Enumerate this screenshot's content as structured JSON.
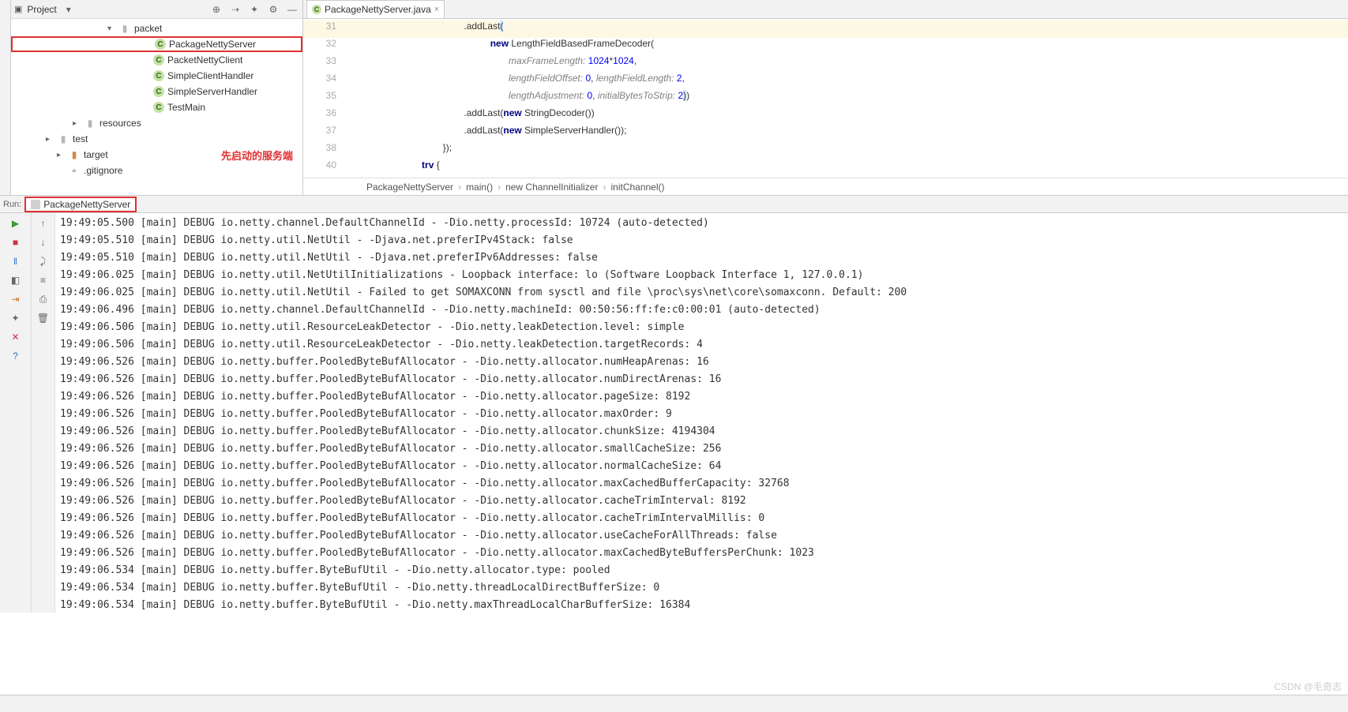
{
  "project_panel": {
    "title": "Project",
    "items": [
      {
        "type": "folder",
        "label": "packet",
        "indent": "indent1",
        "arrow": "▾"
      },
      {
        "type": "class",
        "label": "PackageNettyServer",
        "indent": "indent2",
        "boxed": true
      },
      {
        "type": "class",
        "label": "PacketNettyClient",
        "indent": "indent2"
      },
      {
        "type": "class",
        "label": "SimpleClientHandler",
        "indent": "indent2"
      },
      {
        "type": "class",
        "label": "SimpleServerHandler",
        "indent": "indent2"
      },
      {
        "type": "class",
        "label": "TestMain",
        "indent": "indent2"
      },
      {
        "type": "folder",
        "label": "resources",
        "indent": "indentA",
        "arrow": "▸"
      },
      {
        "type": "folder",
        "label": "test",
        "indent": "indentB",
        "arrow": "▸"
      },
      {
        "type": "folder",
        "label": "target",
        "indent": "indentC",
        "arrow": "▸",
        "note": "先启动的服务端",
        "folder_color": "#d28b3f"
      },
      {
        "type": "file",
        "label": ".gitignore",
        "indent": "indentC"
      }
    ]
  },
  "editor": {
    "tab": {
      "name": "PackageNettyServer.java"
    },
    "lines": [
      {
        "n": 31,
        "hl": true,
        "html": "                                              .addLast<span class='sel'>(</span>"
      },
      {
        "n": 32,
        "html": "                                                        <span class='kw'>new</span> LengthFieldBasedFrameDecoder("
      },
      {
        "n": 33,
        "html": "                                                               <span class='param'>maxFrameLength:</span> <span class='num'>1024</span>*<span class='num'>1024</span>,"
      },
      {
        "n": 34,
        "html": "                                                               <span class='param'>lengthFieldOffset:</span> <span class='num'>0</span>, <span class='param'>lengthFieldLength:</span> <span class='num'>2</span>,"
      },
      {
        "n": 35,
        "html": "                                                               <span class='param'>lengthAdjustment:</span> <span class='num'>0</span>, <span class='param'>initialBytesToStrip:</span> <span class='num'>2</span><span class='sel'>)</span>)"
      },
      {
        "n": 36,
        "html": "                                              .addLast(<span class='kw'>new</span> StringDecoder())"
      },
      {
        "n": 37,
        "html": "                                              .addLast(<span class='kw'>new</span> SimpleServerHandler());"
      },
      {
        "n": 38,
        "html": "                                      });"
      },
      {
        "n": 40,
        "html": "                              <span class='kw'>trv</span> {"
      }
    ],
    "breadcrumb": [
      "PackageNettyServer",
      "main()",
      "new ChannelInitializer",
      "initChannel()"
    ]
  },
  "run": {
    "label": "Run:",
    "tab": "PackageNettyServer"
  },
  "console_lines": [
    "19:49:05.500 [main] DEBUG io.netty.channel.DefaultChannelId - -Dio.netty.processId: 10724 (auto-detected)",
    "19:49:05.510 [main] DEBUG io.netty.util.NetUtil - -Djava.net.preferIPv4Stack: false",
    "19:49:05.510 [main] DEBUG io.netty.util.NetUtil - -Djava.net.preferIPv6Addresses: false",
    "19:49:06.025 [main] DEBUG io.netty.util.NetUtilInitializations - Loopback interface: lo (Software Loopback Interface 1, 127.0.0.1)",
    "19:49:06.025 [main] DEBUG io.netty.util.NetUtil - Failed to get SOMAXCONN from sysctl and file \\proc\\sys\\net\\core\\somaxconn. Default: 200",
    "19:49:06.496 [main] DEBUG io.netty.channel.DefaultChannelId - -Dio.netty.machineId: 00:50:56:ff:fe:c0:00:01 (auto-detected)",
    "19:49:06.506 [main] DEBUG io.netty.util.ResourceLeakDetector - -Dio.netty.leakDetection.level: simple",
    "19:49:06.506 [main] DEBUG io.netty.util.ResourceLeakDetector - -Dio.netty.leakDetection.targetRecords: 4",
    "19:49:06.526 [main] DEBUG io.netty.buffer.PooledByteBufAllocator - -Dio.netty.allocator.numHeapArenas: 16",
    "19:49:06.526 [main] DEBUG io.netty.buffer.PooledByteBufAllocator - -Dio.netty.allocator.numDirectArenas: 16",
    "19:49:06.526 [main] DEBUG io.netty.buffer.PooledByteBufAllocator - -Dio.netty.allocator.pageSize: 8192",
    "19:49:06.526 [main] DEBUG io.netty.buffer.PooledByteBufAllocator - -Dio.netty.allocator.maxOrder: 9",
    "19:49:06.526 [main] DEBUG io.netty.buffer.PooledByteBufAllocator - -Dio.netty.allocator.chunkSize: 4194304",
    "19:49:06.526 [main] DEBUG io.netty.buffer.PooledByteBufAllocator - -Dio.netty.allocator.smallCacheSize: 256",
    "19:49:06.526 [main] DEBUG io.netty.buffer.PooledByteBufAllocator - -Dio.netty.allocator.normalCacheSize: 64",
    "19:49:06.526 [main] DEBUG io.netty.buffer.PooledByteBufAllocator - -Dio.netty.allocator.maxCachedBufferCapacity: 32768",
    "19:49:06.526 [main] DEBUG io.netty.buffer.PooledByteBufAllocator - -Dio.netty.allocator.cacheTrimInterval: 8192",
    "19:49:06.526 [main] DEBUG io.netty.buffer.PooledByteBufAllocator - -Dio.netty.allocator.cacheTrimIntervalMillis: 0",
    "19:49:06.526 [main] DEBUG io.netty.buffer.PooledByteBufAllocator - -Dio.netty.allocator.useCacheForAllThreads: false",
    "19:49:06.526 [main] DEBUG io.netty.buffer.PooledByteBufAllocator - -Dio.netty.allocator.maxCachedByteBuffersPerChunk: 1023",
    "19:49:06.534 [main] DEBUG io.netty.buffer.ByteBufUtil - -Dio.netty.allocator.type: pooled",
    "19:49:06.534 [main] DEBUG io.netty.buffer.ByteBufUtil - -Dio.netty.threadLocalDirectBufferSize: 0",
    "19:49:06.534 [main] DEBUG io.netty.buffer.ByteBufUtil - -Dio.netty.maxThreadLocalCharBufferSize: 16384"
  ],
  "watermark": "CSDN @毛奇志"
}
